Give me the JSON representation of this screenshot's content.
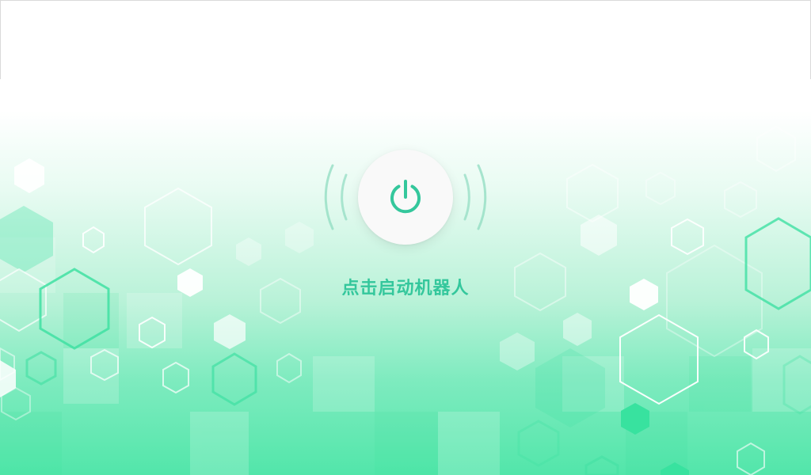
{
  "app": {
    "start_label": "点击启动机器人"
  },
  "icons": {
    "power": "power-icon",
    "wave": "signal-wave-icon"
  },
  "colors": {
    "accent": "#34c79c",
    "wave": "#8fdcc0",
    "button_bg": "#f9f9f9",
    "background_bottom": "#52e6aa"
  }
}
